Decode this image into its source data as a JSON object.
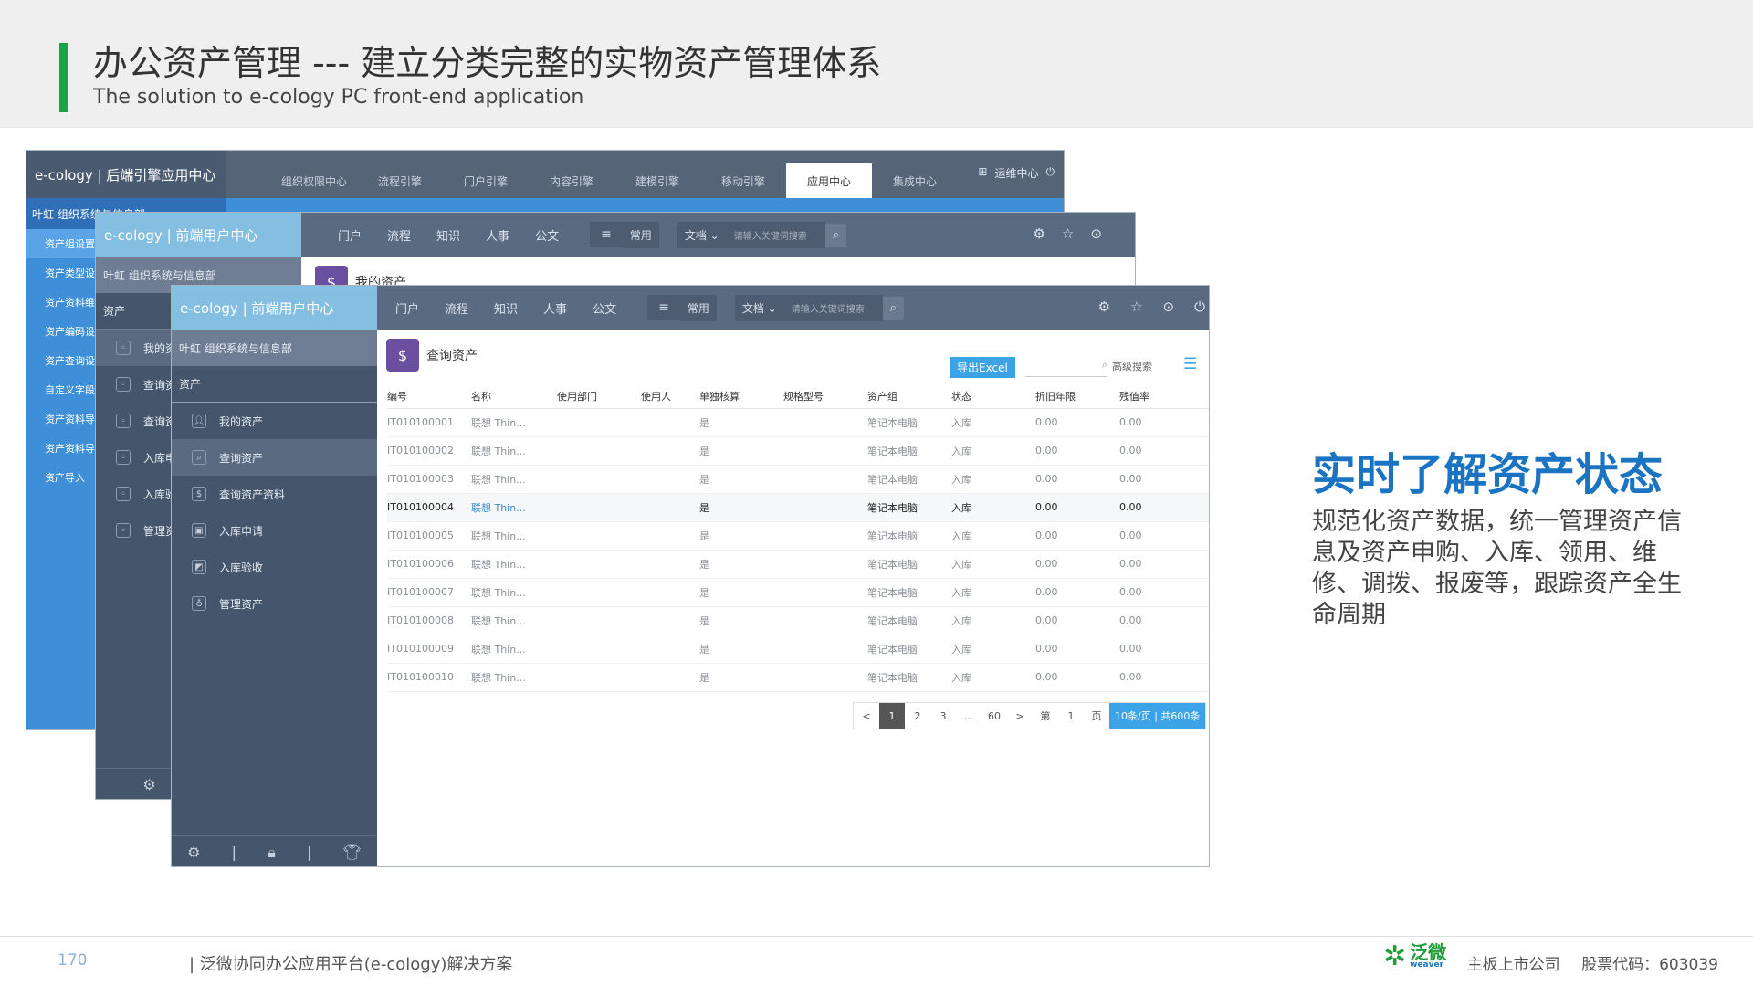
{
  "slide": {
    "title": "办公资产管理 --- 建立分类完整的实物资产管理体系",
    "subtitle": "The solution to e-cology PC front-end application"
  },
  "colors": {
    "accent": "#16a34a",
    "heading": "#1b74c2",
    "nav": "#5a6a80",
    "sidebar": "#45556c",
    "logo": "#84bfe1",
    "back_sidebar": "#3f8fd8",
    "excel": "#3ba3e6"
  },
  "win1": {
    "logo": "e-cology | 后端引擎应用中心",
    "tabs": [
      "组织权限中心",
      "流程引擎",
      "门户引擎",
      "内容引擎",
      "建模引擎",
      "移动引擎",
      "应用中心",
      "集成中心"
    ],
    "active_tab": "应用中心",
    "tail": "运维中心",
    "crumb": "叶虹  组织系统与信息部",
    "side_items": [
      "资产组设置",
      "资产类型设置",
      "资产资料维护",
      "资产编码设置",
      "资产查询设置",
      "自定义字段",
      "资产资料导入",
      "资产资料导出",
      "资产导入"
    ]
  },
  "win2": {
    "logo": "e-cology | 前端用户中心",
    "nav": [
      "门户",
      "流程",
      "知识",
      "人事",
      "公文"
    ],
    "common": "常用",
    "doc": "文档",
    "search_placeholder": "请输入关键词搜索",
    "crumb": "叶虹  组织系统与信息部",
    "section": "资产",
    "side_items": [
      "我的资产",
      "查询资产",
      "查询资产资料",
      "入库申请",
      "入库验收",
      "管理资产"
    ],
    "page_title": "我的资产"
  },
  "win3": {
    "logo": "e-cology | 前端用户中心",
    "nav": [
      "门户",
      "流程",
      "知识",
      "人事",
      "公文"
    ],
    "common": "常用",
    "doc": "文档",
    "search_placeholder": "请输入关键词搜索",
    "crumb": "叶虹  组织系统与信息部",
    "section": "资产",
    "side_items": [
      {
        "label": "我的资产",
        "icon": "person-icon"
      },
      {
        "label": "查询资产",
        "icon": "search-icon"
      },
      {
        "label": "查询资产资料",
        "icon": "doc-icon"
      },
      {
        "label": "入库申请",
        "icon": "image-icon"
      },
      {
        "label": "入库验收",
        "icon": "chart-icon"
      },
      {
        "label": "管理资产",
        "icon": "moneybag-icon"
      }
    ],
    "selected_item": "查询资产",
    "page_title": "查询资产",
    "export_label": "导出Excel",
    "adv_search": "高级搜索",
    "columns": [
      "编号",
      "名称",
      "使用部门",
      "使用人",
      "单独核算",
      "规格型号",
      "资产组",
      "状态",
      "折旧年限",
      "残值率"
    ],
    "rows": [
      [
        "IT010100001",
        "联想 Thin...",
        "",
        "",
        "是",
        "",
        "笔记本电脑",
        "入库",
        "0.00",
        "0.00"
      ],
      [
        "IT010100002",
        "联想 Thin...",
        "",
        "",
        "是",
        "",
        "笔记本电脑",
        "入库",
        "0.00",
        "0.00"
      ],
      [
        "IT010100003",
        "联想 Thin...",
        "",
        "",
        "是",
        "",
        "笔记本电脑",
        "入库",
        "0.00",
        "0.00"
      ],
      [
        "IT010100004",
        "联想 Thin...",
        "",
        "",
        "是",
        "",
        "笔记本电脑",
        "入库",
        "0.00",
        "0.00"
      ],
      [
        "IT010100005",
        "联想 Thin...",
        "",
        "",
        "是",
        "",
        "笔记本电脑",
        "入库",
        "0.00",
        "0.00"
      ],
      [
        "IT010100006",
        "联想 Thin...",
        "",
        "",
        "是",
        "",
        "笔记本电脑",
        "入库",
        "0.00",
        "0.00"
      ],
      [
        "IT010100007",
        "联想 Thin...",
        "",
        "",
        "是",
        "",
        "笔记本电脑",
        "入库",
        "0.00",
        "0.00"
      ],
      [
        "IT010100008",
        "联想 Thin...",
        "",
        "",
        "是",
        "",
        "笔记本电脑",
        "入库",
        "0.00",
        "0.00"
      ],
      [
        "IT010100009",
        "联想 Thin...",
        "",
        "",
        "是",
        "",
        "笔记本电脑",
        "入库",
        "0.00",
        "0.00"
      ],
      [
        "IT010100010",
        "联想 Thin...",
        "",
        "",
        "是",
        "",
        "笔记本电脑",
        "入库",
        "0.00",
        "0.00"
      ]
    ],
    "highlight_row": 3,
    "pager": {
      "prev": "<",
      "pages": [
        "1",
        "2",
        "3",
        "…",
        "60"
      ],
      "current": "1",
      "next": ">",
      "goto_pre": "第",
      "goto_val": "1",
      "goto_post": "页",
      "summary": "10条/页 | 共600条"
    }
  },
  "right": {
    "heading": "实时了解资产状态",
    "body": "规范化资产数据，统一管理资产信息及资产申购、入库、领用、维修、调拨、报废等，跟踪资产全生命周期"
  },
  "footer": {
    "page": "170",
    "text": "| 泛微协同办公应用平台(e-cology)解决方案",
    "logo": "泛微",
    "logo_sub": "weaver",
    "listed": "主板上市公司",
    "stock": "股票代码：603039"
  }
}
